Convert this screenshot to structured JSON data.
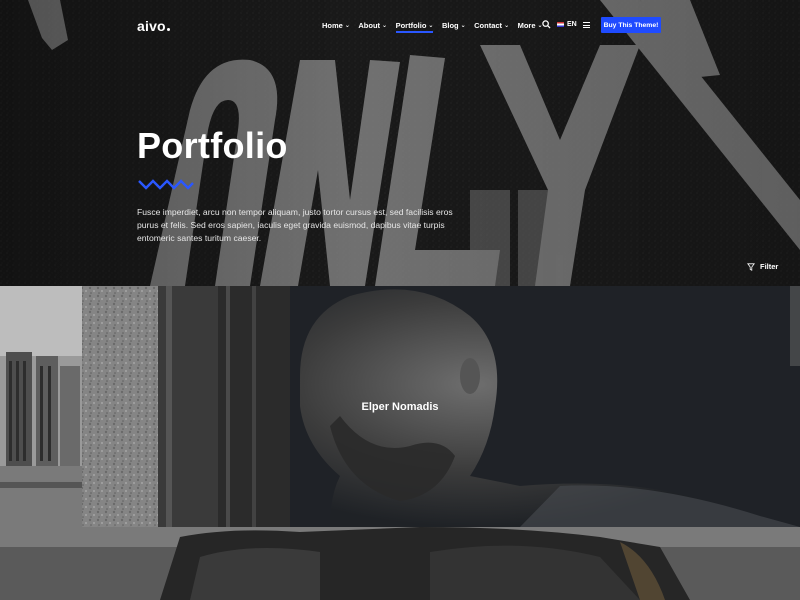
{
  "nav": {
    "logo": "aivo",
    "menu": [
      {
        "label": "Home",
        "active": false
      },
      {
        "label": "About",
        "active": false
      },
      {
        "label": "Portfolio",
        "active": true
      },
      {
        "label": "Blog",
        "active": false
      },
      {
        "label": "Contact",
        "active": false
      },
      {
        "label": "More",
        "active": false
      }
    ],
    "search_icon": "search-icon",
    "language": "EN",
    "menu_icon": "hamburger-icon",
    "cta_label": "Buy This Theme!"
  },
  "hero": {
    "title": "Portfolio",
    "intro": "Fusce imperdiet, arcu non tempor aliquam, justo tortor cursus est, sed facilisis eros purus et felis. Sed eros sapien, iaculis eget gravida euismod, dapibus vitae turpis entomeric santes turitum caeser.",
    "filter_label": "Filter",
    "filter_icon": "filter-icon"
  },
  "portfolio_items": [
    {
      "title": "Elper Nomadis"
    },
    {
      "title": ""
    }
  ],
  "colors": {
    "accent": "#1f4bff",
    "text": "#ffffff",
    "background": "#111111"
  }
}
